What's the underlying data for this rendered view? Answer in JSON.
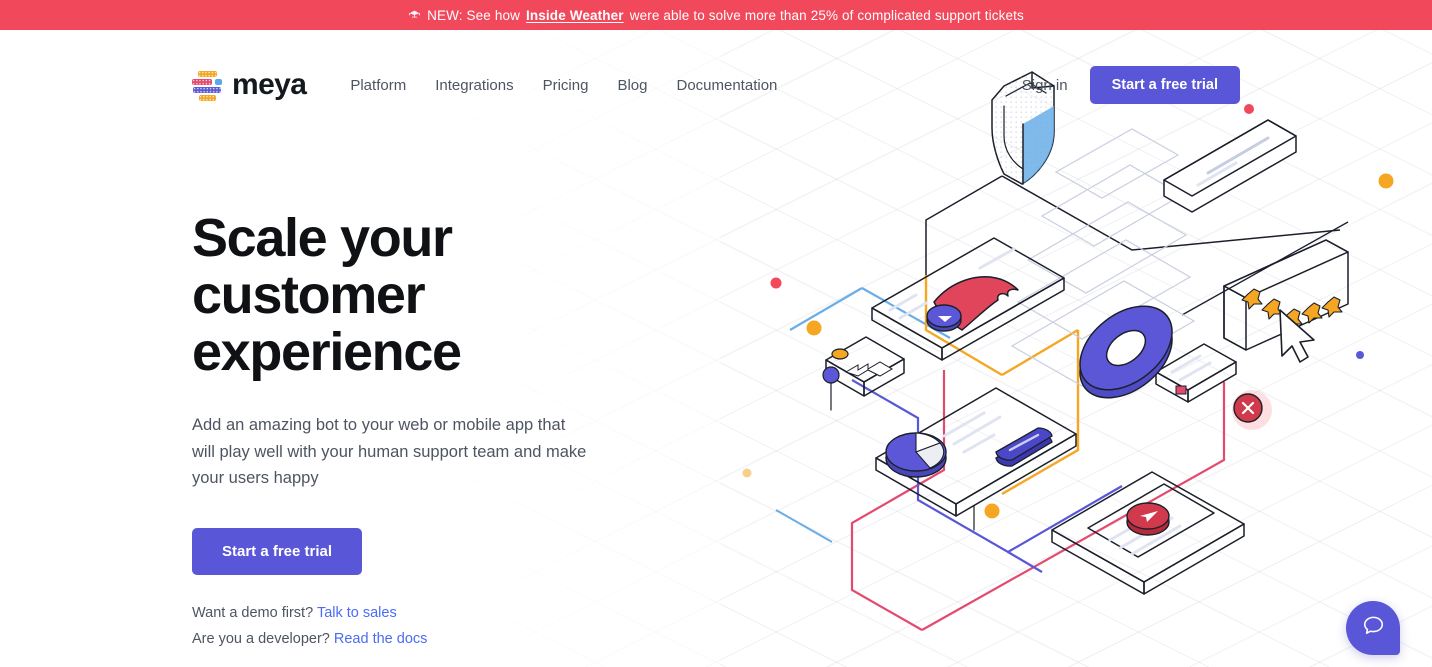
{
  "announcement": {
    "icon": "megaphone-icon",
    "icon_glyph": "☏",
    "prefix": "NEW: See how",
    "link_text": "Inside Weather",
    "suffix": "were able to solve more than 25% of complicated support tickets",
    "background_color": "#f2485b",
    "text_color": "#ffffff"
  },
  "header": {
    "brand": {
      "name": "meya",
      "logo_name": "meya-logo"
    },
    "nav": [
      {
        "label": "Platform",
        "name": "nav-platform"
      },
      {
        "label": "Integrations",
        "name": "nav-integrations"
      },
      {
        "label": "Pricing",
        "name": "nav-pricing"
      },
      {
        "label": "Blog",
        "name": "nav-blog"
      },
      {
        "label": "Documentation",
        "name": "nav-documentation"
      }
    ],
    "sign_in_label": "Sign in",
    "cta_label": "Start a free trial"
  },
  "hero": {
    "title": "Scale your customer experience",
    "subtitle": "Add an amazing bot to your web or mobile app that will play well with your human support team and make your users happy",
    "cta_label": "Start a free trial",
    "demo_note_text": "Want a demo first?",
    "demo_note_link": "Talk to sales",
    "dev_note_text": "Are you a developer?",
    "dev_note_link": "Read the docs"
  },
  "chat_widget": {
    "name": "chat-bubble-icon",
    "aria_label": "Open chat"
  },
  "colors": {
    "brand_purple": "#5a56d8",
    "banner_red": "#f2485b",
    "link_blue": "#4a6cf7",
    "accent_yellow": "#f5a623",
    "accent_pink": "#e24a6e",
    "accent_blue": "#59a9e8",
    "heading_dark": "#0f1115",
    "body_gray": "#4d5561"
  }
}
